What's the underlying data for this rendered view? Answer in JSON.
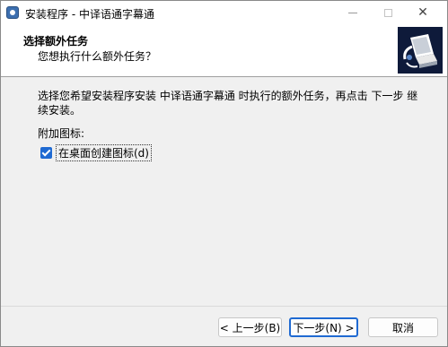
{
  "window": {
    "title": "安装程序 - 中译语通字幕通",
    "controls": {
      "minimize_icon": "minimize-icon",
      "maximize_icon": "maximize-icon",
      "close_glyph": "✕"
    }
  },
  "header": {
    "title": "选择额外任务",
    "subtitle": "您想执行什么额外任务？",
    "logo_icon": "computer-install-icon"
  },
  "content": {
    "instruction": "选择您希望安装程序安装 中译语通字幕通 时执行的额外任务，再点击 下一步 继续安装。",
    "addon_label": "附加图标:",
    "tasks": [
      {
        "label": "在桌面创建图标(d)",
        "checked": true
      }
    ]
  },
  "footer": {
    "back_label": "< 上一步(B)",
    "next_label": "下一步(N) >",
    "cancel_label": "取消"
  },
  "colors": {
    "accent": "#1f6ad2",
    "logo_bg": "#0e1a3a",
    "window_bg": "#f0f0f0"
  }
}
